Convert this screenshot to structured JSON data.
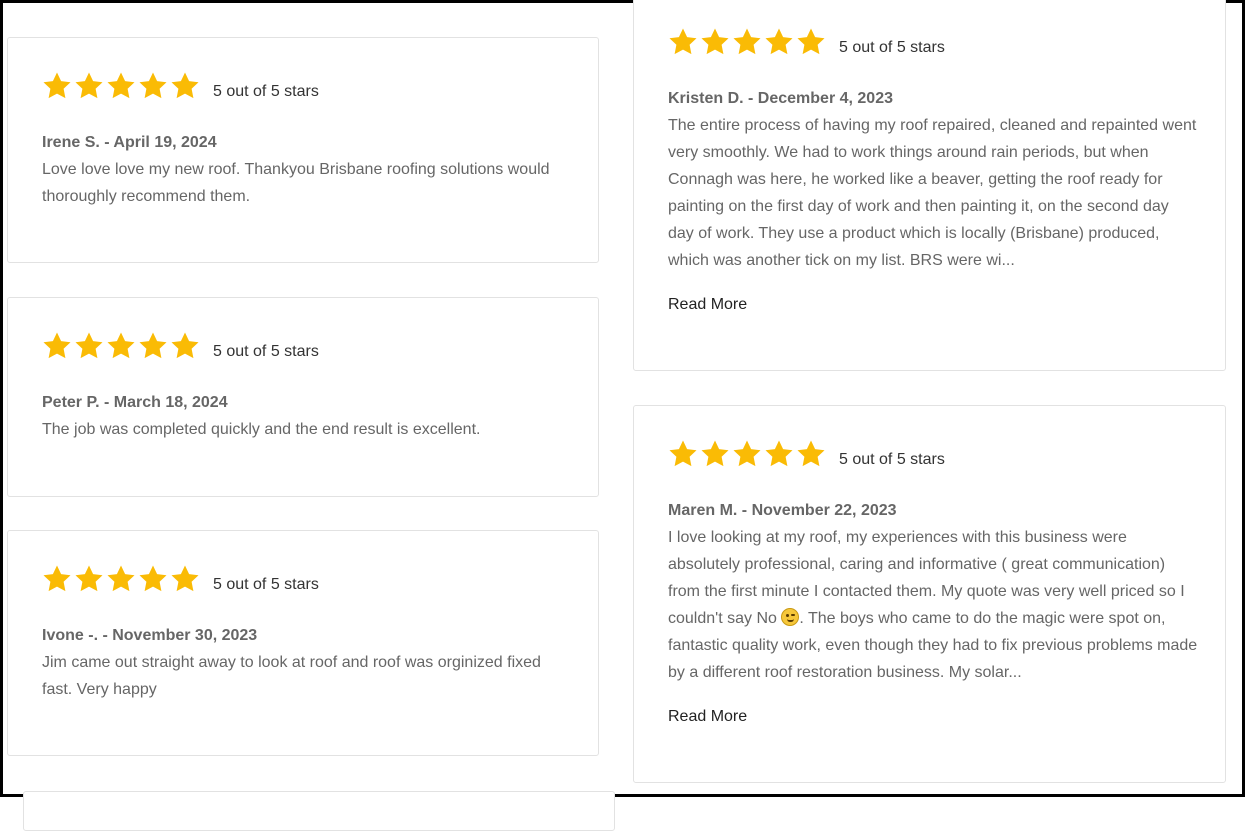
{
  "colors": {
    "star": "#FABB05",
    "card_border": "#e2e2e2",
    "text_muted": "#666666"
  },
  "reviews_left": [
    {
      "rating_text": "5 out of 5 stars",
      "author_date": "Irene S. - April 19, 2024",
      "lines": [
        "Love love love my new roof. Thankyou Brisbane roofing solutions would",
        "thoroughly recommend them."
      ]
    },
    {
      "rating_text": "5 out of 5 stars",
      "author_date": "Peter P. - March 18, 2024",
      "lines": [
        "The job was completed quickly and the end result is excellent."
      ]
    },
    {
      "rating_text": "5 out of 5 stars",
      "author_date": "Ivone -. - November 30, 2023",
      "lines": [
        "Jim came out straight away to look at roof and roof was orginized fixed",
        "fast. Very happy"
      ]
    }
  ],
  "reviews_right": [
    {
      "rating_text": "5 out of 5 stars",
      "author_date": "Kristen D. - December 4, 2023",
      "lines": [
        "The entire process of having my roof repaired, cleaned and repainted went",
        "very smoothly. We had to work things around rain periods, but when",
        "Connagh was here, he worked like a beaver, getting the roof ready for",
        "painting on the first day of work and then painting it, on the second day",
        "day of work. They use a product which is locally (Brisbane) produced,",
        "which was another tick on my list. BRS were wi..."
      ],
      "read_more": "Read More"
    },
    {
      "rating_text": "5 out of 5 stars",
      "author_date": "Maren M. - November 22, 2023",
      "lines": [
        "I love looking at my roof, my experiences with this business were",
        "absolutely professional, caring and informative ( great communication)",
        "from the first minute I contacted them. My quote was very well priced so I",
        "couldn't say No",
        ". The boys who came to do the magic were spot on,",
        "fantastic quality work, even though they had to fix previous problems made",
        "by a different roof restoration business. My solar..."
      ],
      "read_more": "Read More"
    }
  ],
  "star_rating_value": 5,
  "star_rating_max": 5
}
